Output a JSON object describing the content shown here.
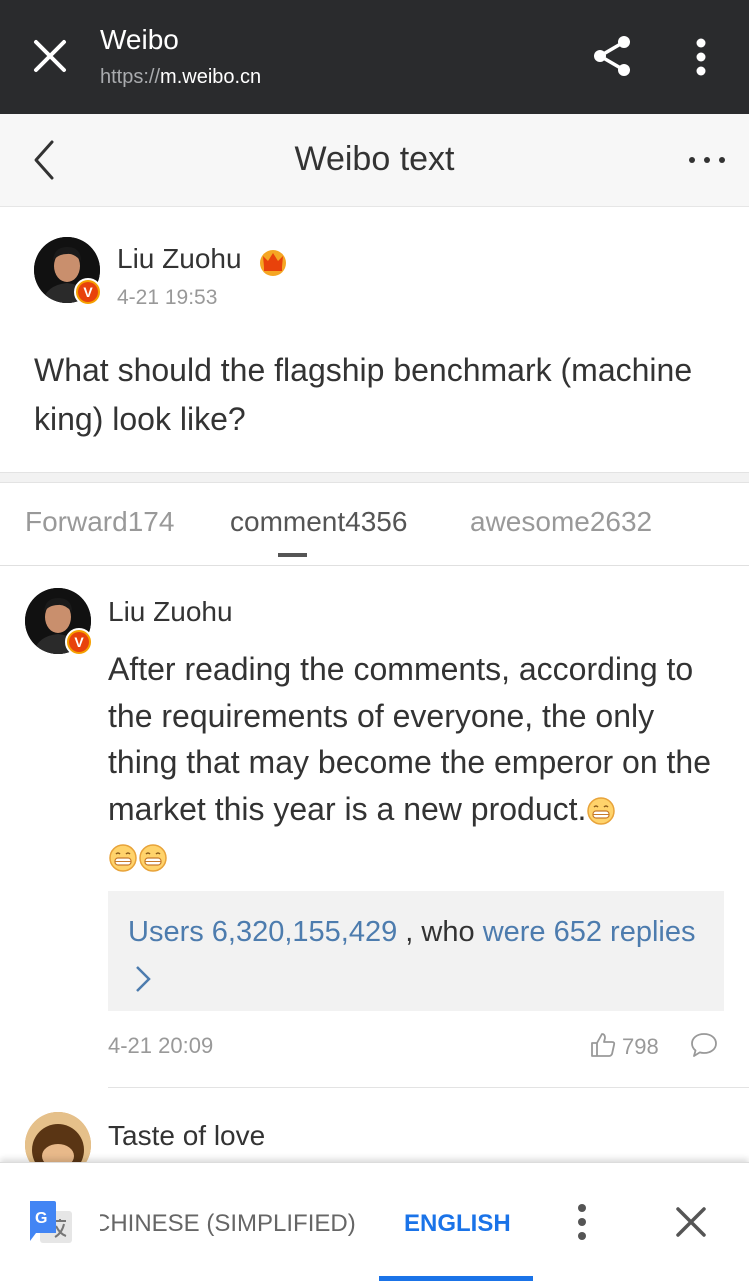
{
  "browser": {
    "title": "Weibo",
    "url_scheme": "https://",
    "url_host": "m.weibo.cn"
  },
  "page": {
    "title": "Weibo text"
  },
  "post": {
    "author": "Liu Zuohu",
    "badge_letter": "V",
    "time": "4-21 19:53",
    "text": "What should the flagship benchmark (machine king) look like?"
  },
  "tabs": [
    {
      "label": "Forward174",
      "active": false
    },
    {
      "label": "comment4356",
      "active": true
    },
    {
      "label": "awesome2632",
      "active": false
    }
  ],
  "comments": [
    {
      "author": "Liu Zuohu",
      "text": "After reading the comments, according to the requirements of everyone, the only thing that may become the emperor on the market this year is a new product.",
      "reply_users": "Users 6,320,155,429",
      "reply_mid": " , who ",
      "reply_count": "were 652 replies",
      "time": "4-21 20:09",
      "likes": "798"
    },
    {
      "author": "Taste of love"
    }
  ],
  "translate": {
    "source_lang": "CHINESE (SIMPLIFIED)",
    "target_lang": "ENGLISH"
  },
  "colors": {
    "topbar": "#2a2b2d",
    "link": "#4d7cae",
    "translate_accent": "#1a73e8",
    "badge": "#e8420b"
  }
}
